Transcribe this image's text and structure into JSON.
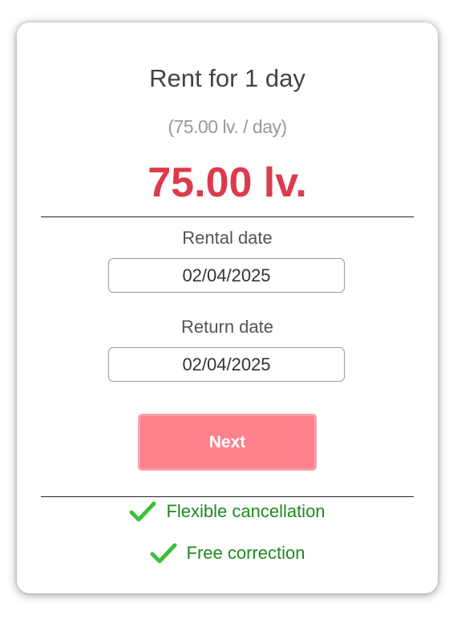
{
  "summary": {
    "title": "Rent for 1 day",
    "per_day": "(75.00 lv. / day)",
    "total": "75.00 lv."
  },
  "rental_date": {
    "label": "Rental date",
    "value": "02/04/2025"
  },
  "return_date": {
    "label": "Return date",
    "value": "02/04/2025"
  },
  "next_button": {
    "label": "Next"
  },
  "features": [
    {
      "label": "Flexible cancellation",
      "icon": "check-icon"
    },
    {
      "label": "Free correction",
      "icon": "check-icon"
    }
  ],
  "colors": {
    "price": "#db3b4c",
    "button": "#ff818e",
    "feature_text": "#1e8a1e",
    "check": "#3cbf3c"
  }
}
